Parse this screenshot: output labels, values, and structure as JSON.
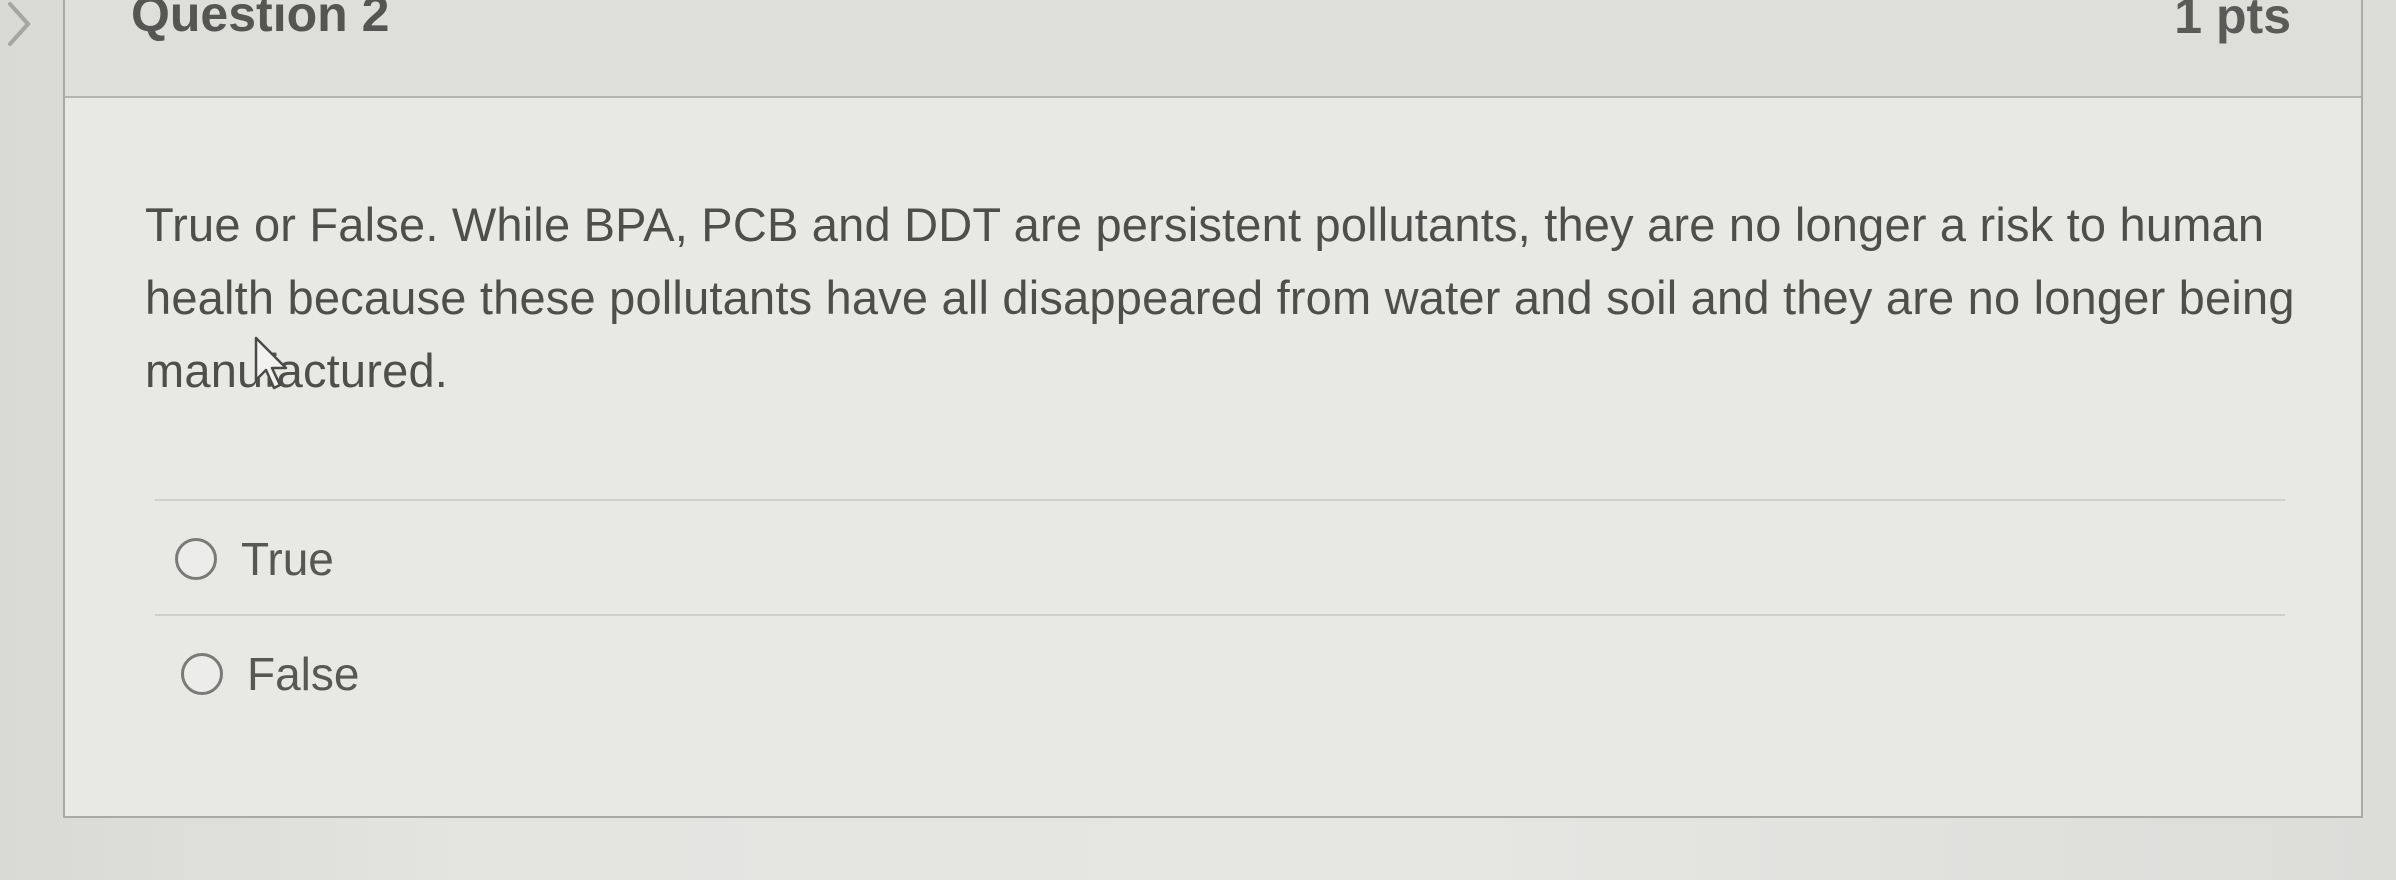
{
  "question": {
    "title": "Question 2",
    "points": "1 pts",
    "text": "True or False.  While BPA, PCB and DDT are persistent pollutants, they are no longer a risk to human health because these pollutants have all disappeared from water and soil and they are no longer being manufactured."
  },
  "answers": [
    {
      "label": "True",
      "selected": false
    },
    {
      "label": "False",
      "selected": false
    }
  ],
  "icons": {
    "nav": "chevron-right-icon",
    "cursor": "mouse-pointer-icon"
  }
}
